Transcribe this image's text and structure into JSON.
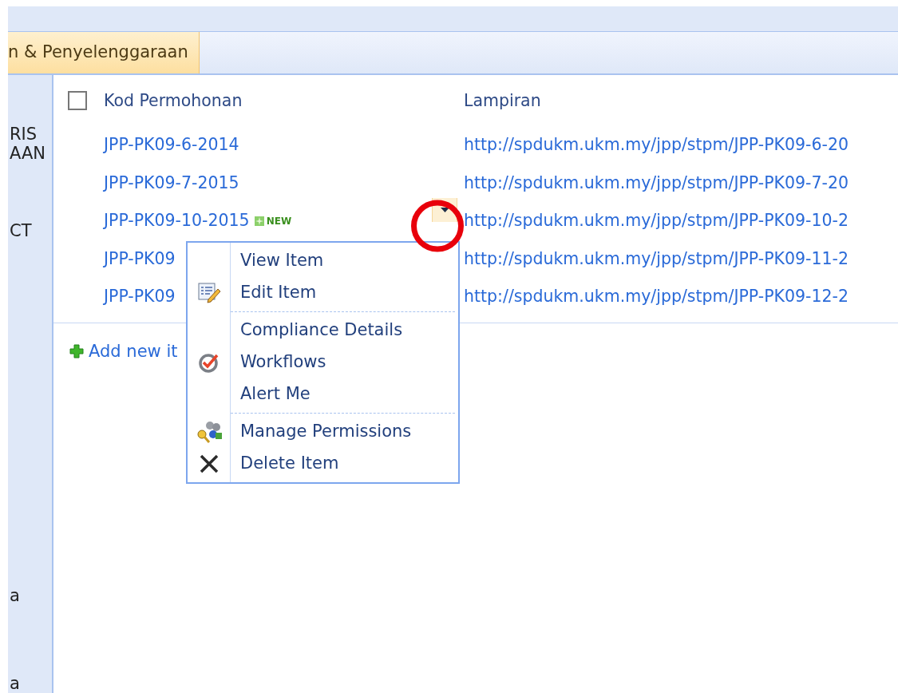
{
  "tab": {
    "label": "n & Penyelenggaraan",
    "selected": true
  },
  "sidebar": {
    "items": [
      {
        "label": "RIS"
      },
      {
        "label": "AAN"
      },
      {
        "label": "CT"
      },
      {
        "label": "a"
      },
      {
        "label": "a"
      }
    ]
  },
  "table": {
    "select_all": {
      "checked": false
    },
    "columns": [
      "Kod Permohonan",
      "Lampiran"
    ],
    "rows": [
      {
        "code": "JPP-PK09-6-2014",
        "new": false,
        "menu_open": false,
        "url": "http://spdukm.ukm.my/jpp/stpm/JPP-PK09-6-20"
      },
      {
        "code": "JPP-PK09-7-2015",
        "new": false,
        "menu_open": false,
        "url": "http://spdukm.ukm.my/jpp/stpm/JPP-PK09-7-20"
      },
      {
        "code": "JPP-PK09-10-2015",
        "new": true,
        "new_label": "NEW",
        "menu_open": true,
        "url": "http://spdukm.ukm.my/jpp/stpm/JPP-PK09-10-2"
      },
      {
        "code": "JPP-PK09",
        "new": false,
        "menu_open": false,
        "url": "http://spdukm.ukm.my/jpp/stpm/JPP-PK09-11-2"
      },
      {
        "code": "JPP-PK09",
        "new": false,
        "menu_open": false,
        "url": "http://spdukm.ukm.my/jpp/stpm/JPP-PK09-12-2"
      }
    ]
  },
  "add_new": {
    "label": "Add new it"
  },
  "context_menu": {
    "groups": [
      [
        {
          "label": "View Item",
          "kind": "plain"
        },
        {
          "label": "Edit Item",
          "kind": "edit"
        }
      ],
      [
        {
          "label": "Compliance Details",
          "kind": "plain"
        },
        {
          "label": "Workflows",
          "kind": "workflow"
        },
        {
          "label": "Alert Me",
          "kind": "plain"
        }
      ],
      [
        {
          "label": "Manage Permissions",
          "kind": "permissions"
        },
        {
          "label": "Delete Item",
          "kind": "delete"
        }
      ]
    ]
  }
}
